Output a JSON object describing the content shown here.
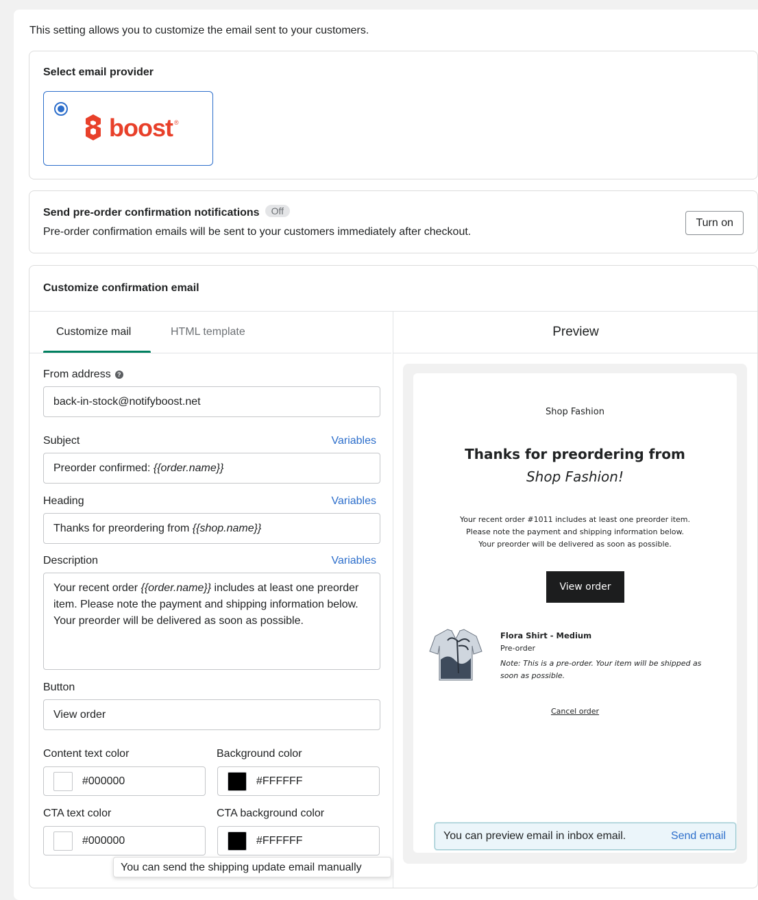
{
  "intro": "This setting allows you to customize the email sent to your customers.",
  "provider_section": {
    "title": "Select email provider",
    "selected_provider": "boost",
    "logo_text": "boost",
    "logo_reg": "®",
    "brand_color": "#e8402a"
  },
  "notifications": {
    "title": "Send pre-order confirmation notifications",
    "status": "Off",
    "description": "Pre-order confirmation emails will be sent to your customers immediately after checkout.",
    "button": "Turn on"
  },
  "customize": {
    "title": "Customize confirmation email",
    "tabs": [
      {
        "label": "Customize mail",
        "active": true
      },
      {
        "label": "HTML template",
        "active": false
      }
    ],
    "preview_title": "Preview",
    "accent_color": "#008060",
    "from_address": {
      "label": "From address",
      "value": "back-in-stock@notifyboost.net"
    },
    "subject": {
      "label": "Subject",
      "variables": "Variables",
      "prefix": "Preorder confirmed: ",
      "var": "{{order.name}}"
    },
    "heading": {
      "label": "Heading",
      "variables": "Variables",
      "prefix": "Thanks for preordering from ",
      "var": "{{shop.name}}"
    },
    "description": {
      "label": "Description",
      "variables": "Variables",
      "prefix": "Your recent order ",
      "var": "{{order.name}}",
      "suffix": " includes at least one preorder item. Please note the payment and shipping information below. Your preorder will be delivered as soon as possible."
    },
    "button": {
      "label": "Button",
      "value": "View order"
    },
    "colors": [
      {
        "label": "Content text color",
        "value": "#000000",
        "swatch": "#FFFFFF"
      },
      {
        "label": "Background color",
        "value": "#FFFFFF",
        "swatch": "#000000"
      },
      {
        "label": "CTA text color",
        "value": "#000000",
        "swatch": "#FFFFFF"
      },
      {
        "label": "CTA background color",
        "value": "#FFFFFF",
        "swatch": "#000000"
      }
    ]
  },
  "preview": {
    "shop": "Shop Fashion",
    "heading_line1": "Thanks for preordering from",
    "heading_line2": "Shop Fashion!",
    "desc_lines": [
      "Your recent order #1011 includes at least one preorder item.",
      "Please note the payment and shipping information below.",
      "Your preorder will be delivered as soon as possible."
    ],
    "button": "View order",
    "item_name": "Flora Shirt - Medium",
    "item_type": "Pre-order",
    "item_note": "Note: This is a pre-order. Your item will be shipped as soon as possible.",
    "cancel": "Cancel order",
    "inbox_text": "You can preview email in inbox email.",
    "inbox_link": "Send email"
  },
  "tooltip": "You can send the shipping update email manually"
}
